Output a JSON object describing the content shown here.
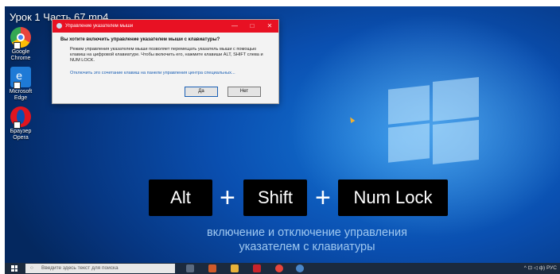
{
  "video": {
    "title": "Урок 1 Часть 67.mp4"
  },
  "desktop_icons": [
    {
      "label": "Google Chrome",
      "color": "#e8453c"
    },
    {
      "label": "Microsoft Edge",
      "color": "#1e7ad6"
    },
    {
      "label": "Браузер Opera",
      "color": "#e0151f"
    }
  ],
  "dialog": {
    "title": "Управление указателем мыши",
    "question": "Вы хотите включить управление указателем мыши с клавиатуры?",
    "body": "Режим управления указателем мыши позволяет перемещать указатель мыши с помощью клавиш на цифровой клавиатуре. Чтобы включить его, нажмите клавиши ALT, SHIFT слева и NUM LOCK.",
    "link": "Отключить это сочетание клавиш на панели управления центра специальных...",
    "yes_label": "Да",
    "no_label": "Нет",
    "minimize": "—",
    "maximize": "□",
    "close": "✕"
  },
  "keys": {
    "alt": "Alt",
    "plus1": "+",
    "shift": "Shift",
    "plus2": "+",
    "numlock": "Num Lock"
  },
  "caption": {
    "line1": "включение и отключение управления",
    "line2": "указателем с клавиатуры"
  },
  "taskbar": {
    "search_placeholder": "Введите здесь текст для поиска",
    "search_glyph": "○",
    "tray_text": "^ ⊡ ◁ ф) РУС"
  },
  "colors": {
    "title_bar": "#e81123",
    "accent": "#1478d8",
    "caption": "#9fc8f0"
  }
}
